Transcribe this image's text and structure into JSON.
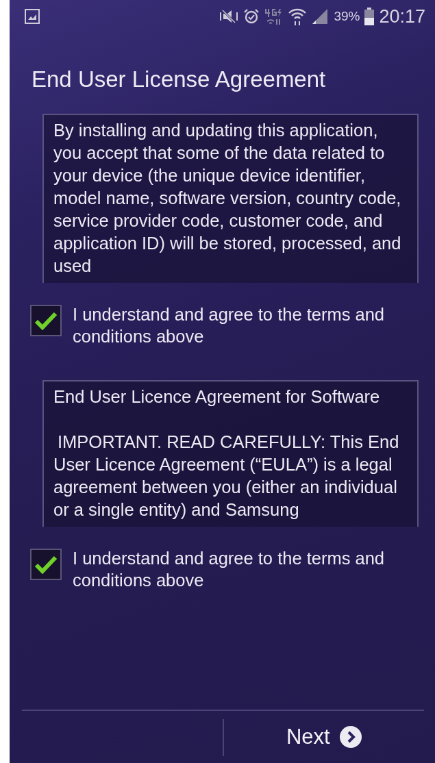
{
  "status_bar": {
    "battery_text": "39%",
    "time": "20:17"
  },
  "title": "End User License Agreement",
  "sections": [
    {
      "paragraphs": [
        "By installing and updating this application, you accept that some of the data related to your device (the unique device identifier, model name, software version, country code, service provider code, customer code, and application ID) will be stored, processed, and used"
      ],
      "agree": {
        "label": "I understand and agree to the terms and conditions above",
        "checked": true
      }
    },
    {
      "paragraphs": [
        "End User Licence Agreement for Software",
        "IMPORTANT. READ CAREFULLY: This End User Licence Agreement (“EULA”) is a legal agreement between you (either an individual or a single entity) and Samsung"
      ],
      "agree": {
        "label": "I understand and agree to the terms and conditions above",
        "checked": true
      }
    }
  ],
  "next_button": {
    "label": "Next"
  }
}
